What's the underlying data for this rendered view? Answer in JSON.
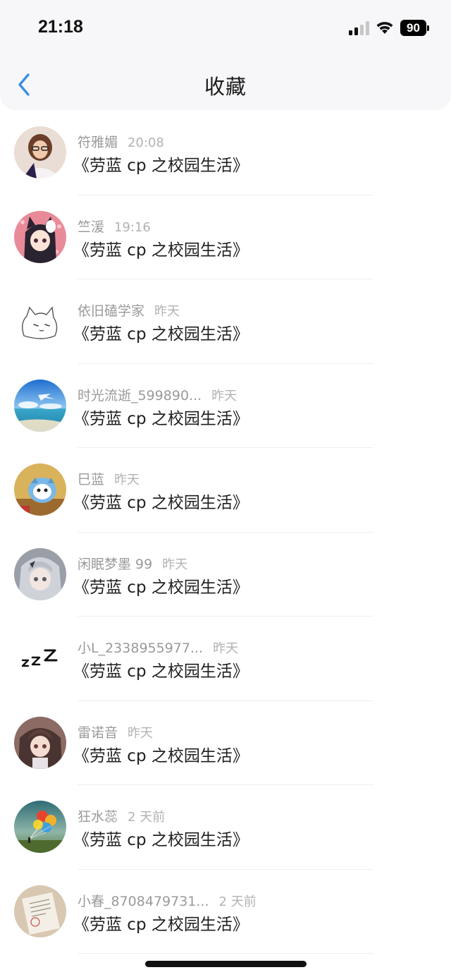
{
  "status_bar": {
    "time": "21:18",
    "battery": "90",
    "icons": [
      "signal-icon",
      "wifi-icon",
      "battery-icon"
    ]
  },
  "header": {
    "title": "收藏",
    "back_icon": "chevron-left-icon",
    "accent_color": "#3a8ee6"
  },
  "favorites": [
    {
      "user": "符雅媚",
      "time": "20:08",
      "title": "《劳蓝 cp 之校园生活》"
    },
    {
      "user": "竺湲",
      "time": "19:16",
      "title": "《劳蓝 cp 之校园生活》"
    },
    {
      "user": "依旧磕学家",
      "time": "昨天",
      "title": "《劳蓝 cp 之校园生活》"
    },
    {
      "user": "时光流逝_599890...",
      "time": "昨天",
      "title": "《劳蓝 cp 之校园生活》"
    },
    {
      "user": "巳蓝",
      "time": "昨天",
      "title": "《劳蓝 cp 之校园生活》"
    },
    {
      "user": "闲眠梦墨 99",
      "time": "昨天",
      "title": "《劳蓝 cp 之校园生活》"
    },
    {
      "user": "小L_2338955977...",
      "time": "昨天",
      "title": "《劳蓝 cp 之校园生活》"
    },
    {
      "user": "雷诺音",
      "time": "昨天",
      "title": "《劳蓝 cp 之校园生活》"
    },
    {
      "user": "狂水蕊",
      "time": "2 天前",
      "title": "《劳蓝 cp 之校园生活》"
    },
    {
      "user": "小春_8708479731...",
      "time": "2 天前",
      "title": "《劳蓝 cp 之校园生活》"
    }
  ]
}
